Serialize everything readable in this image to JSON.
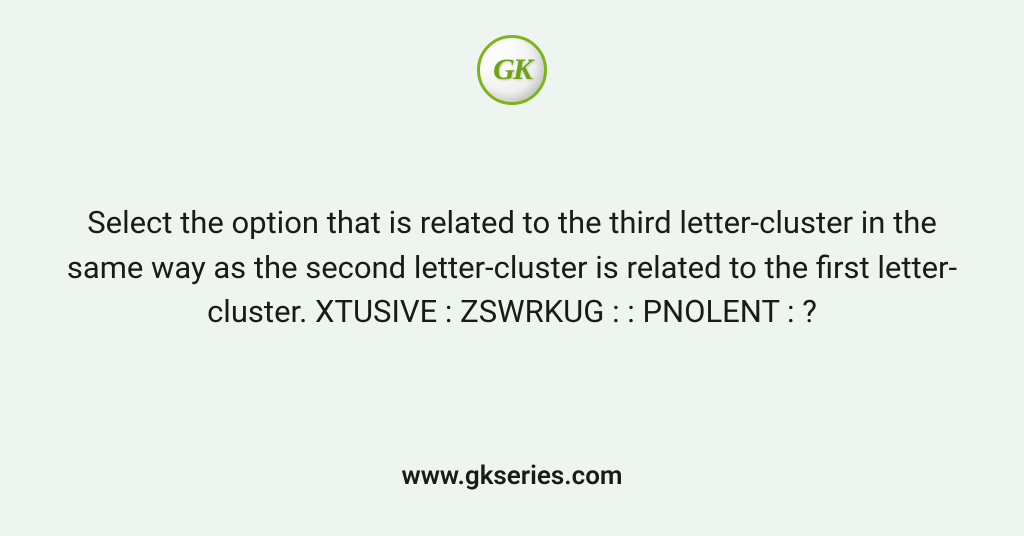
{
  "logo": {
    "text": "GK"
  },
  "question": {
    "text": "Select the option that is related to the third letter-cluster in the same way as the second letter-cluster is related to the first letter-cluster. XTUSIVE : ZSWRKUG : : PNOLENT : ?"
  },
  "footer": {
    "url": "www.gkseries.com"
  }
}
